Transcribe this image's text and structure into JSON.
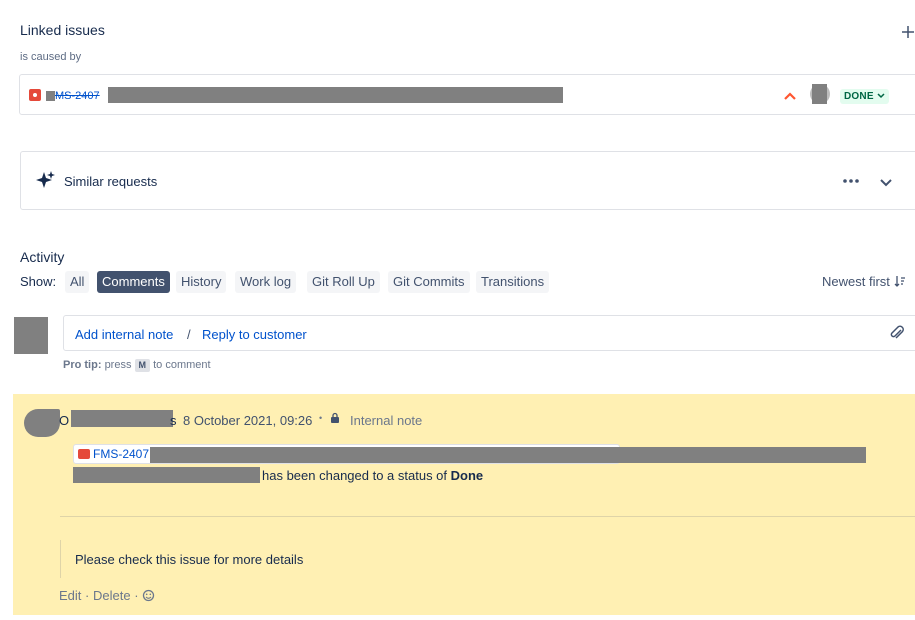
{
  "linked_issues": {
    "title": "Linked issues",
    "add_icon": "plus",
    "relation": "is caused by",
    "item": {
      "type_icon": "bug-icon",
      "key": "MS-2407",
      "priority_icon": "chevron-up-icon",
      "priority_color": "#ff5630",
      "status": "DONE"
    }
  },
  "similar_requests": {
    "icon": "sparkle-icon",
    "title": "Similar requests",
    "more_icon": "ellipsis-icon",
    "expand_icon": "chevron-down-icon"
  },
  "activity": {
    "title": "Activity",
    "show_label": "Show:",
    "filters": [
      "All",
      "Comments",
      "History",
      "Work log",
      "Git Roll Up",
      "Git Commits",
      "Transitions"
    ],
    "active_filter": "Comments",
    "sort_label": "Newest first",
    "sort_icon": "sort-icon"
  },
  "composer": {
    "add_internal_note": "Add internal note",
    "separator": "/",
    "reply_to_customer": "Reply to customer",
    "attach_icon": "paperclip-icon",
    "tip_label": "Pro tip:",
    "tip_press": "press",
    "tip_key": "M",
    "tip_suffix": "to comment"
  },
  "note": {
    "author_prefix": "O",
    "author_suffix": "s",
    "timestamp": "8 October 2021, 09:26",
    "dot": "•",
    "lock_icon": "lock-icon",
    "visibility": "Internal note",
    "issue_ref": "FMS-2407:",
    "status_text": "has been changed to a status of",
    "status_value": "Done",
    "message": "Please check this issue for more details",
    "actions": {
      "edit": "Edit",
      "sep": "·",
      "delete": "Delete",
      "emoji_icon": "emoji-icon"
    }
  },
  "colors": {
    "note_bg": "#fff0b3",
    "link": "#0052cc",
    "done_bg": "#e3fcef",
    "done_fg": "#006644"
  }
}
